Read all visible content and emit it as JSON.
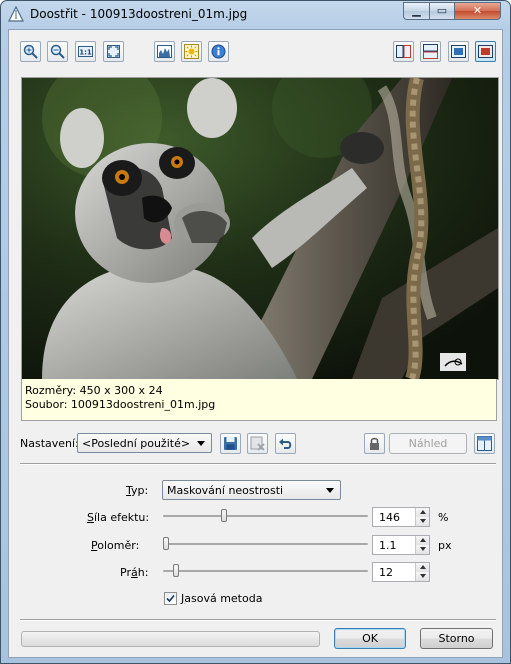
{
  "window": {
    "title": "Doostřit - 100913doostreni_01m.jpg",
    "controls": [
      "minimize",
      "maximize",
      "close"
    ]
  },
  "toolbar": {
    "left": [
      {
        "name": "zoom-in-icon",
        "tooltip_icon": "magnifier-plus"
      },
      {
        "name": "zoom-out-icon",
        "tooltip_icon": "magnifier-minus"
      },
      {
        "name": "actual-size-icon",
        "label": "1:1"
      },
      {
        "name": "fit-window-icon",
        "tooltip_icon": "expand-arrows"
      },
      {
        "name": "histogram-icon",
        "tooltip_icon": "histogram"
      },
      {
        "name": "highlight-icon",
        "tooltip_icon": "sun"
      },
      {
        "name": "info-icon",
        "tooltip_icon": "info"
      }
    ],
    "right": [
      {
        "name": "split-vertical-icon"
      },
      {
        "name": "split-horizontal-icon"
      },
      {
        "name": "single-view-icon"
      },
      {
        "name": "original-view-icon"
      }
    ]
  },
  "image_info": {
    "dimensions": "Rozměry: 450 x 300 x 24",
    "file": "Soubor: 100913doostreni_01m.jpg"
  },
  "preset": {
    "label": "Nastavení:",
    "value": "<Poslední použité>",
    "preview_button": "Náhled"
  },
  "settings": {
    "type": {
      "label_prefix": "",
      "label_key": "T",
      "label_rest": "yp:",
      "value": "Maskování neostrosti"
    },
    "strength": {
      "label_key": "S",
      "label_rest": "íla efektu:",
      "value": "146",
      "unit": "%",
      "level": 0.29
    },
    "radius": {
      "label_key": "P",
      "label_rest": "oloměr:",
      "value": "1.1",
      "unit": "px",
      "level": 0.0
    },
    "threshold": {
      "label_pre": "Pr",
      "label_key": "á",
      "label_rest": "h:",
      "value": "12",
      "level": 0.05
    },
    "luminance": {
      "label_key": "J",
      "label_rest": "asová metoda",
      "checked": true
    }
  },
  "footer": {
    "ok": "OK",
    "cancel": "Storno"
  },
  "colors": {
    "info_background": "#ffffe1",
    "default_button_border": "#3c7fb1"
  }
}
